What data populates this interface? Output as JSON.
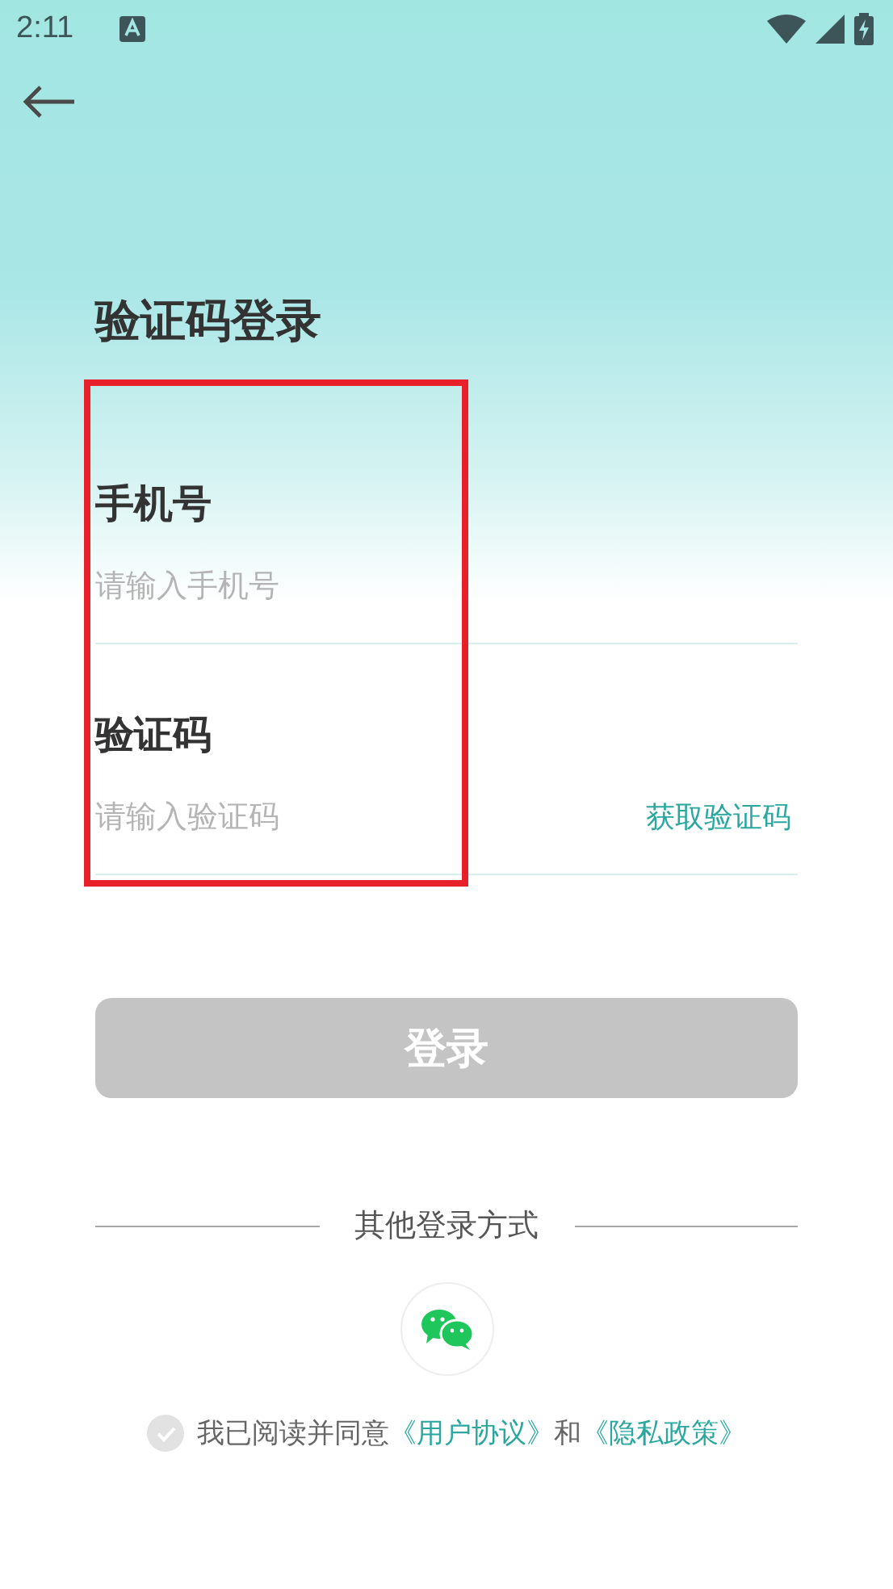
{
  "status_bar": {
    "time": "2:11"
  },
  "title": "验证码登录",
  "fields": [
    {
      "label": "手机号",
      "placeholder": "请输入手机号"
    },
    {
      "label": "验证码",
      "placeholder": "请输入验证码",
      "action": "获取验证码"
    }
  ],
  "login_button": {
    "label": "登录",
    "disabled": true
  },
  "other_login": {
    "label": "其他登录方式"
  },
  "agreement": {
    "checked": false,
    "text": "我已阅读并同意",
    "link_1": "《用户协议》",
    "joiner": "和",
    "link_2": "《隐私政策》"
  },
  "highlight": {
    "kind": "rectangle"
  }
}
